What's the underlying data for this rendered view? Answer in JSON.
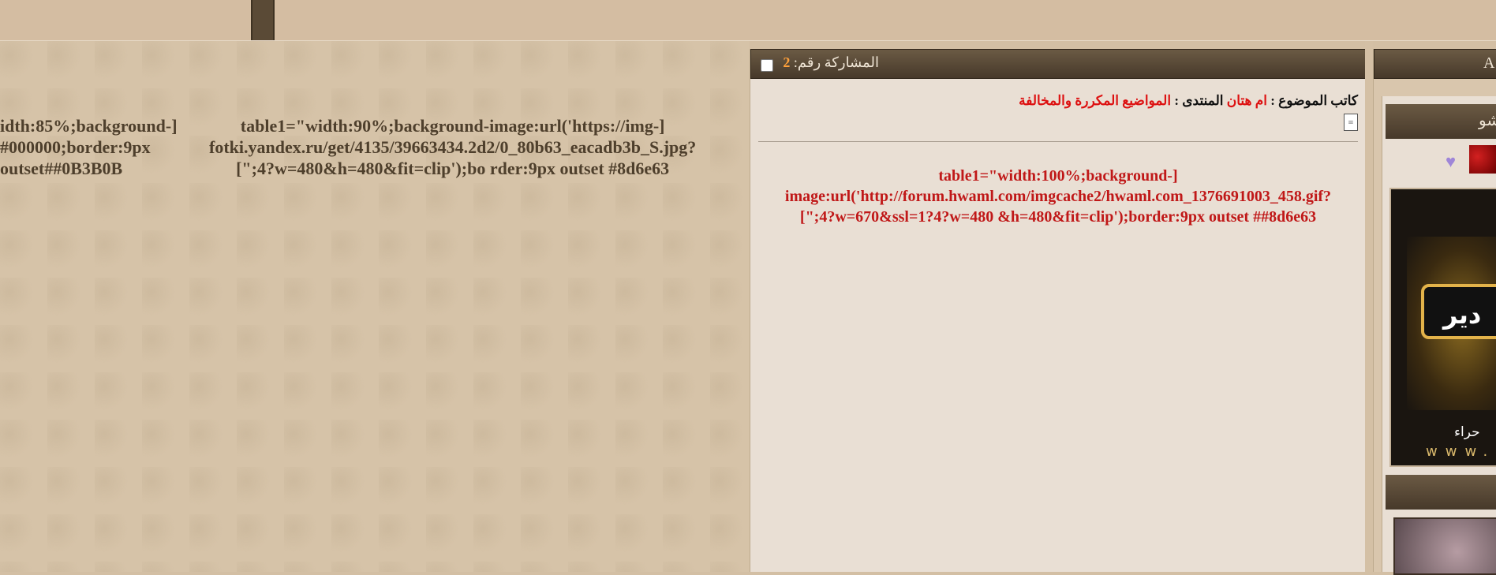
{
  "left_column": {
    "text_a": "table1=\"width:90%;background-image:url('https://img-]\nfotki.yandex.ru/get/4135/39663434.2d2/0_80b63_eacadb3b_S.jpg?\n[\";4?w=480&h=480&fit=clip');bo rder:9px outset #8d6e63",
    "text_b": "idth:85%;background-]\n#000000;border:9px\noutset##0B3B0B"
  },
  "post": {
    "header_label": "المشاركة رقم:",
    "post_number": "2",
    "author_label": "كاتب الموضوع",
    "author_name": "ام هتان",
    "forum_label": "المنتدى",
    "forum_name": "المواضيع المكررة والمخالفة",
    "body_text": "table1=\"width:100%;background-]\nimage:url('http://forum.hwaml.com/imgcache2/hwaml.com_1376691003_458.gif?\n[\";4?w=670&ssl=1?4?w=480 &h=480&fit=clip');border:9px outset ##8d6e63",
    "colors": {
      "accent_red": "#c01818",
      "post_number": "#ffa13b",
      "header_bg": "#47392a"
    }
  },
  "sidebar": {
    "header_text": "A",
    "title_text": "شو",
    "avatar_text": "دير",
    "avatar_subtext": "حراء",
    "avatar_www": "www."
  }
}
